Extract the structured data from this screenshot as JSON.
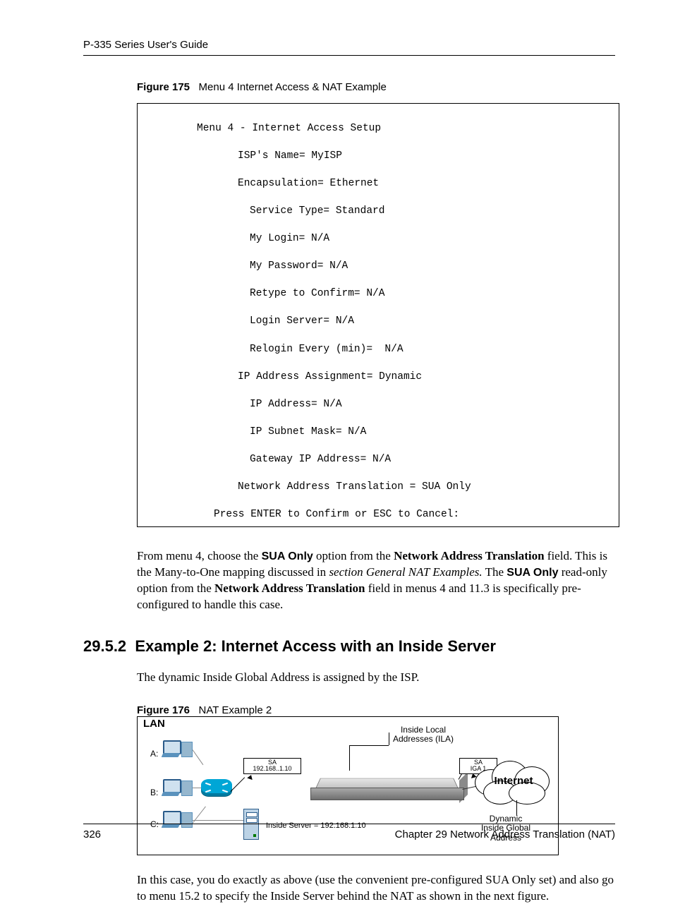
{
  "header": {
    "guide_title": "P-335 Series User's Guide"
  },
  "figure175": {
    "label": "Figure 175",
    "caption": "Menu 4 Internet Access & NAT Example",
    "menu_title": "Menu 4 - Internet Access Setup",
    "lines": {
      "isp": "ISP's Name= MyISP",
      "encap": "Encapsulation= Ethernet",
      "svc": "Service Type= Standard",
      "login": "My Login= N/A",
      "pwd": "My Password= N/A",
      "retype": "Retype to Confirm= N/A",
      "lserver": "Login Server= N/A",
      "relogin": "Relogin Every (min)=  N/A",
      "ipassign": "IP Address Assignment= Dynamic",
      "ipaddr": "IP Address= N/A",
      "subnet": "IP Subnet Mask= N/A",
      "gateway": "Gateway IP Address= N/A",
      "nat": "Network Address Translation = SUA Only"
    },
    "prompt": "Press ENTER to Confirm or ESC to Cancel:"
  },
  "para1": {
    "t1": "From menu 4, choose the ",
    "b1": "SUA Only",
    "t2": " option from the ",
    "b2": "Network Address Translation",
    "t3": " field. This is the Many-to-One mapping discussed in ",
    "i1": "section General NAT Examples.",
    "t4": " The ",
    "b3": "SUA Only",
    "t5": " read-only option from the ",
    "b4": "Network Address Translation",
    "t6": " field in menus 4 and 11.3 is specifically pre-configured to handle this case."
  },
  "section": {
    "num": "29.5.2",
    "title": "Example 2: Internet Access with an Inside Server"
  },
  "para2": "The dynamic Inside Global Address is assigned by the ISP.",
  "figure176": {
    "label": "Figure 176",
    "caption": "NAT Example 2",
    "lan": "LAN",
    "hostA": "A:",
    "hostB": "B:",
    "hostC": "C:",
    "sa1_top": "SA",
    "sa1_bot": "192.168..1.10",
    "sa2_top": "SA",
    "sa2_bot": "IGA 1",
    "ila": "Inside Local\nAddresses (ILA)",
    "server": "Inside Server = 192.168.1.10",
    "internet": "Internet",
    "dynamic": "Dynamic\nInside Global\nAddress"
  },
  "para3": {
    "t1": "In this case, you do exactly as above (use the convenient pre-configured ",
    "b1": "SUA Only",
    "t2": " set) and also go to menu 15.2 to specify the Inside Server behind the NAT as shown in the next figure."
  },
  "footer": {
    "page": "326",
    "chapter": "Chapter 29 Network Address Translation (NAT)"
  }
}
